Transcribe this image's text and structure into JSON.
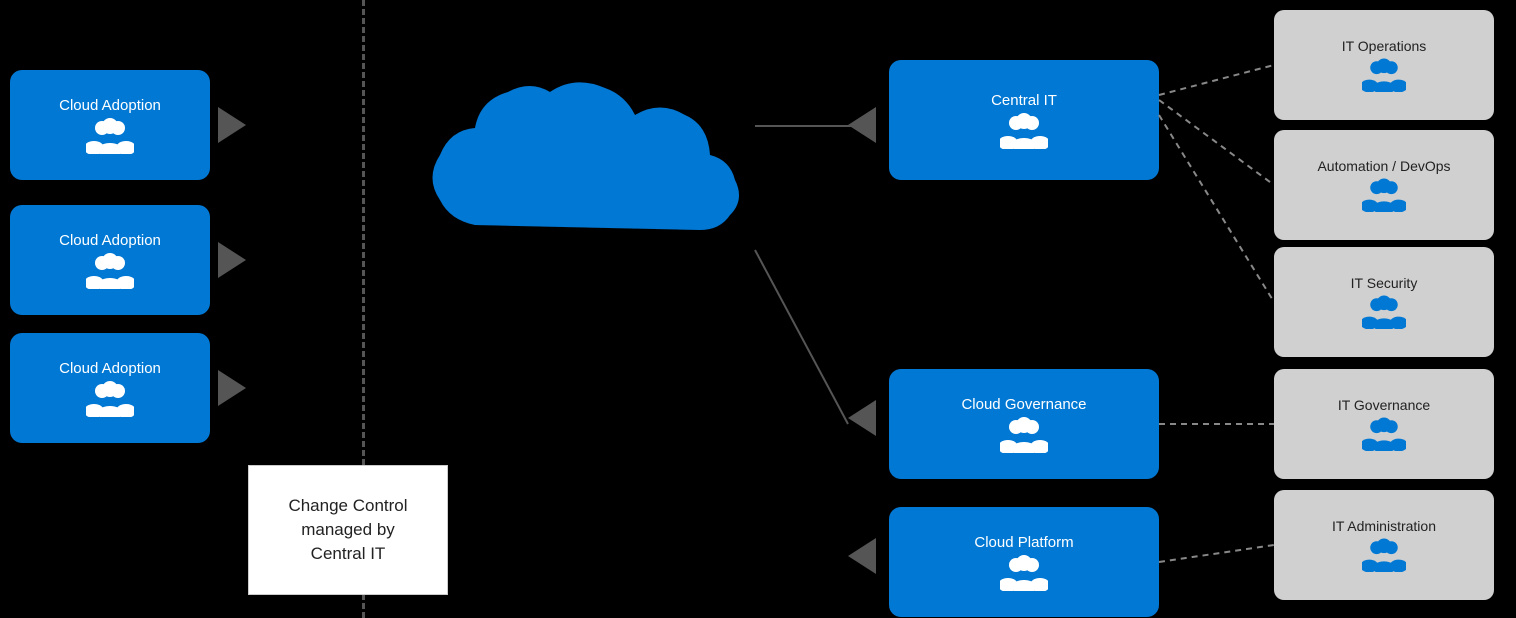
{
  "boxes": {
    "cloud_adoption_1": {
      "label": "Cloud Adoption",
      "icon": "👥"
    },
    "cloud_adoption_2": {
      "label": "Cloud Adoption",
      "icon": "👥"
    },
    "cloud_adoption_3": {
      "label": "Cloud Adoption",
      "icon": "👥"
    },
    "central_it": {
      "label": "Central IT",
      "icon": "👥"
    },
    "cloud_governance": {
      "label": "Cloud Governance",
      "icon": "👥"
    },
    "cloud_platform": {
      "label": "Cloud Platform",
      "icon": "👥"
    }
  },
  "gray_boxes": {
    "it_operations": {
      "label": "IT Operations",
      "icon": "👥"
    },
    "automation_devops": {
      "label": "Automation / DevOps",
      "icon": "👥"
    },
    "it_security": {
      "label": "IT Security",
      "icon": "👥"
    },
    "it_governance": {
      "label": "IT Governance",
      "icon": "👥"
    },
    "it_administration": {
      "label": "IT Administration",
      "icon": "👥"
    }
  },
  "change_control": {
    "text": "Change Control\nmanaged by\nCentral IT"
  },
  "colors": {
    "blue": "#0078d4",
    "gray_box_bg": "#d0d0d0",
    "arrow": "#666",
    "dashed": "#888"
  }
}
